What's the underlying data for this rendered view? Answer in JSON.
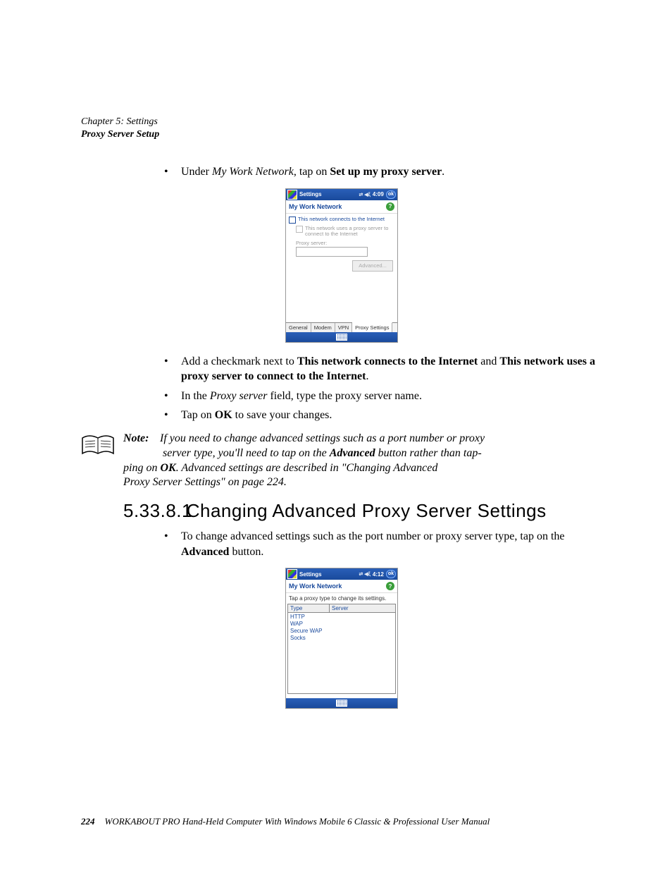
{
  "header": {
    "chapter": "Chapter 5: Settings",
    "section": "Proxy Server Setup"
  },
  "bullets1": {
    "b1_pre": "Under ",
    "b1_em": "My Work Network",
    "b1_mid": ", tap on ",
    "b1_bold": "Set up my proxy server",
    "b1_end": "."
  },
  "screenshot1": {
    "titlebar": {
      "title": "Settings",
      "time": "4:09",
      "ok": "ok"
    },
    "subheader": "My Work Network",
    "check1": "This network connects to the Internet",
    "check2": "This network uses a proxy server to connect to the Internet",
    "fieldLabel": "Proxy server:",
    "advanced": "Advanced...",
    "tabs": [
      "General",
      "Modem",
      "VPN",
      "Proxy Settings"
    ]
  },
  "bullets2": {
    "b1_pre": "Add a checkmark next to ",
    "b1_bold1": "This network connects to the Internet",
    "b1_mid": " and ",
    "b1_bold2": "This network uses a proxy server to connect to the Internet",
    "b1_end": ".",
    "b2_pre": "In the ",
    "b2_em": "Proxy server",
    "b2_end": " field, type the proxy server name.",
    "b3_pre": "Tap on ",
    "b3_bold": "OK",
    "b3_end": " to save your changes."
  },
  "note": {
    "label": "Note:",
    "l1a": "If you need to change advanced settings such as a port number or proxy ",
    "l2a": "server type, you'll need to tap on the ",
    "l2bold": "Advanced",
    "l2b": " button rather than tap-",
    "l3a": "ping on ",
    "l3bold": "OK",
    "l3b": ". Advanced settings are described in \"Changing Advanced ",
    "l4": "Proxy Server Settings\" on page 224."
  },
  "subheading": {
    "num": "5.33.8.1",
    "title": "Changing Advanced Proxy Server Settings"
  },
  "bullets3": {
    "b1_pre": "To change advanced settings such as the port number or proxy server type, tap on the ",
    "b1_bold": "Advanced",
    "b1_end": " button."
  },
  "screenshot2": {
    "titlebar": {
      "title": "Settings",
      "time": "4:12",
      "ok": "ok"
    },
    "subheader": "My Work Network",
    "msg": "Tap a proxy type to change its settings.",
    "cols": [
      "Type",
      "Server"
    ],
    "rows": [
      "HTTP",
      "WAP",
      "Secure WAP",
      "Socks"
    ]
  },
  "footer": {
    "page": "224",
    "text": "WORKABOUT PRO Hand-Held Computer With Windows Mobile 6 Classic & Professional User Manual"
  }
}
